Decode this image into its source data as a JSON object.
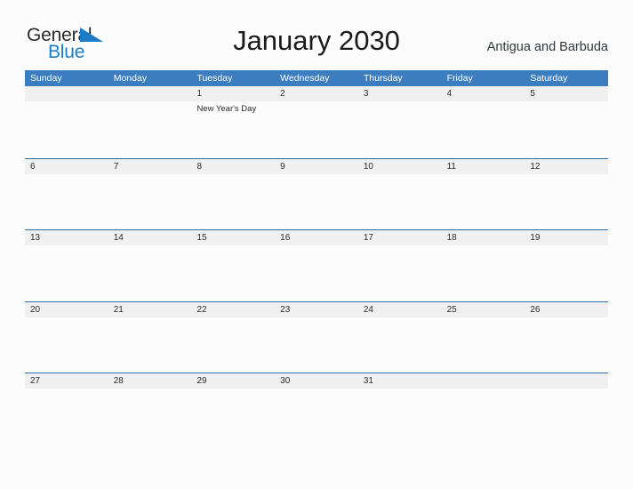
{
  "brand": {
    "name_part1": "General",
    "name_part2": "Blue",
    "flag_icon": "blue-flag-triangle",
    "accent_color": "#1d7cc4",
    "text_color": "#2b2b2b"
  },
  "header": {
    "title": "January 2030",
    "region": "Antigua and Barbuda"
  },
  "theme": {
    "header_bar_color": "#3b7dbf",
    "row_rule_color": "#2e6da4",
    "band_color": "#f0f0f0",
    "page_background": "#fcfcfc"
  },
  "weekdays": [
    "Sunday",
    "Monday",
    "Tuesday",
    "Wednesday",
    "Thursday",
    "Friday",
    "Saturday"
  ],
  "weeks": [
    {
      "days": [
        {
          "number": "",
          "events": []
        },
        {
          "number": "",
          "events": []
        },
        {
          "number": "1",
          "events": [
            "New Year's Day"
          ]
        },
        {
          "number": "2",
          "events": []
        },
        {
          "number": "3",
          "events": []
        },
        {
          "number": "4",
          "events": []
        },
        {
          "number": "5",
          "events": []
        }
      ]
    },
    {
      "days": [
        {
          "number": "6",
          "events": []
        },
        {
          "number": "7",
          "events": []
        },
        {
          "number": "8",
          "events": []
        },
        {
          "number": "9",
          "events": []
        },
        {
          "number": "10",
          "events": []
        },
        {
          "number": "11",
          "events": []
        },
        {
          "number": "12",
          "events": []
        }
      ]
    },
    {
      "days": [
        {
          "number": "13",
          "events": []
        },
        {
          "number": "14",
          "events": []
        },
        {
          "number": "15",
          "events": []
        },
        {
          "number": "16",
          "events": []
        },
        {
          "number": "17",
          "events": []
        },
        {
          "number": "18",
          "events": []
        },
        {
          "number": "19",
          "events": []
        }
      ]
    },
    {
      "days": [
        {
          "number": "20",
          "events": []
        },
        {
          "number": "21",
          "events": []
        },
        {
          "number": "22",
          "events": []
        },
        {
          "number": "23",
          "events": []
        },
        {
          "number": "24",
          "events": []
        },
        {
          "number": "25",
          "events": []
        },
        {
          "number": "26",
          "events": []
        }
      ]
    },
    {
      "days": [
        {
          "number": "27",
          "events": []
        },
        {
          "number": "28",
          "events": []
        },
        {
          "number": "29",
          "events": []
        },
        {
          "number": "30",
          "events": []
        },
        {
          "number": "31",
          "events": []
        },
        {
          "number": "",
          "events": []
        },
        {
          "number": "",
          "events": []
        }
      ]
    }
  ]
}
